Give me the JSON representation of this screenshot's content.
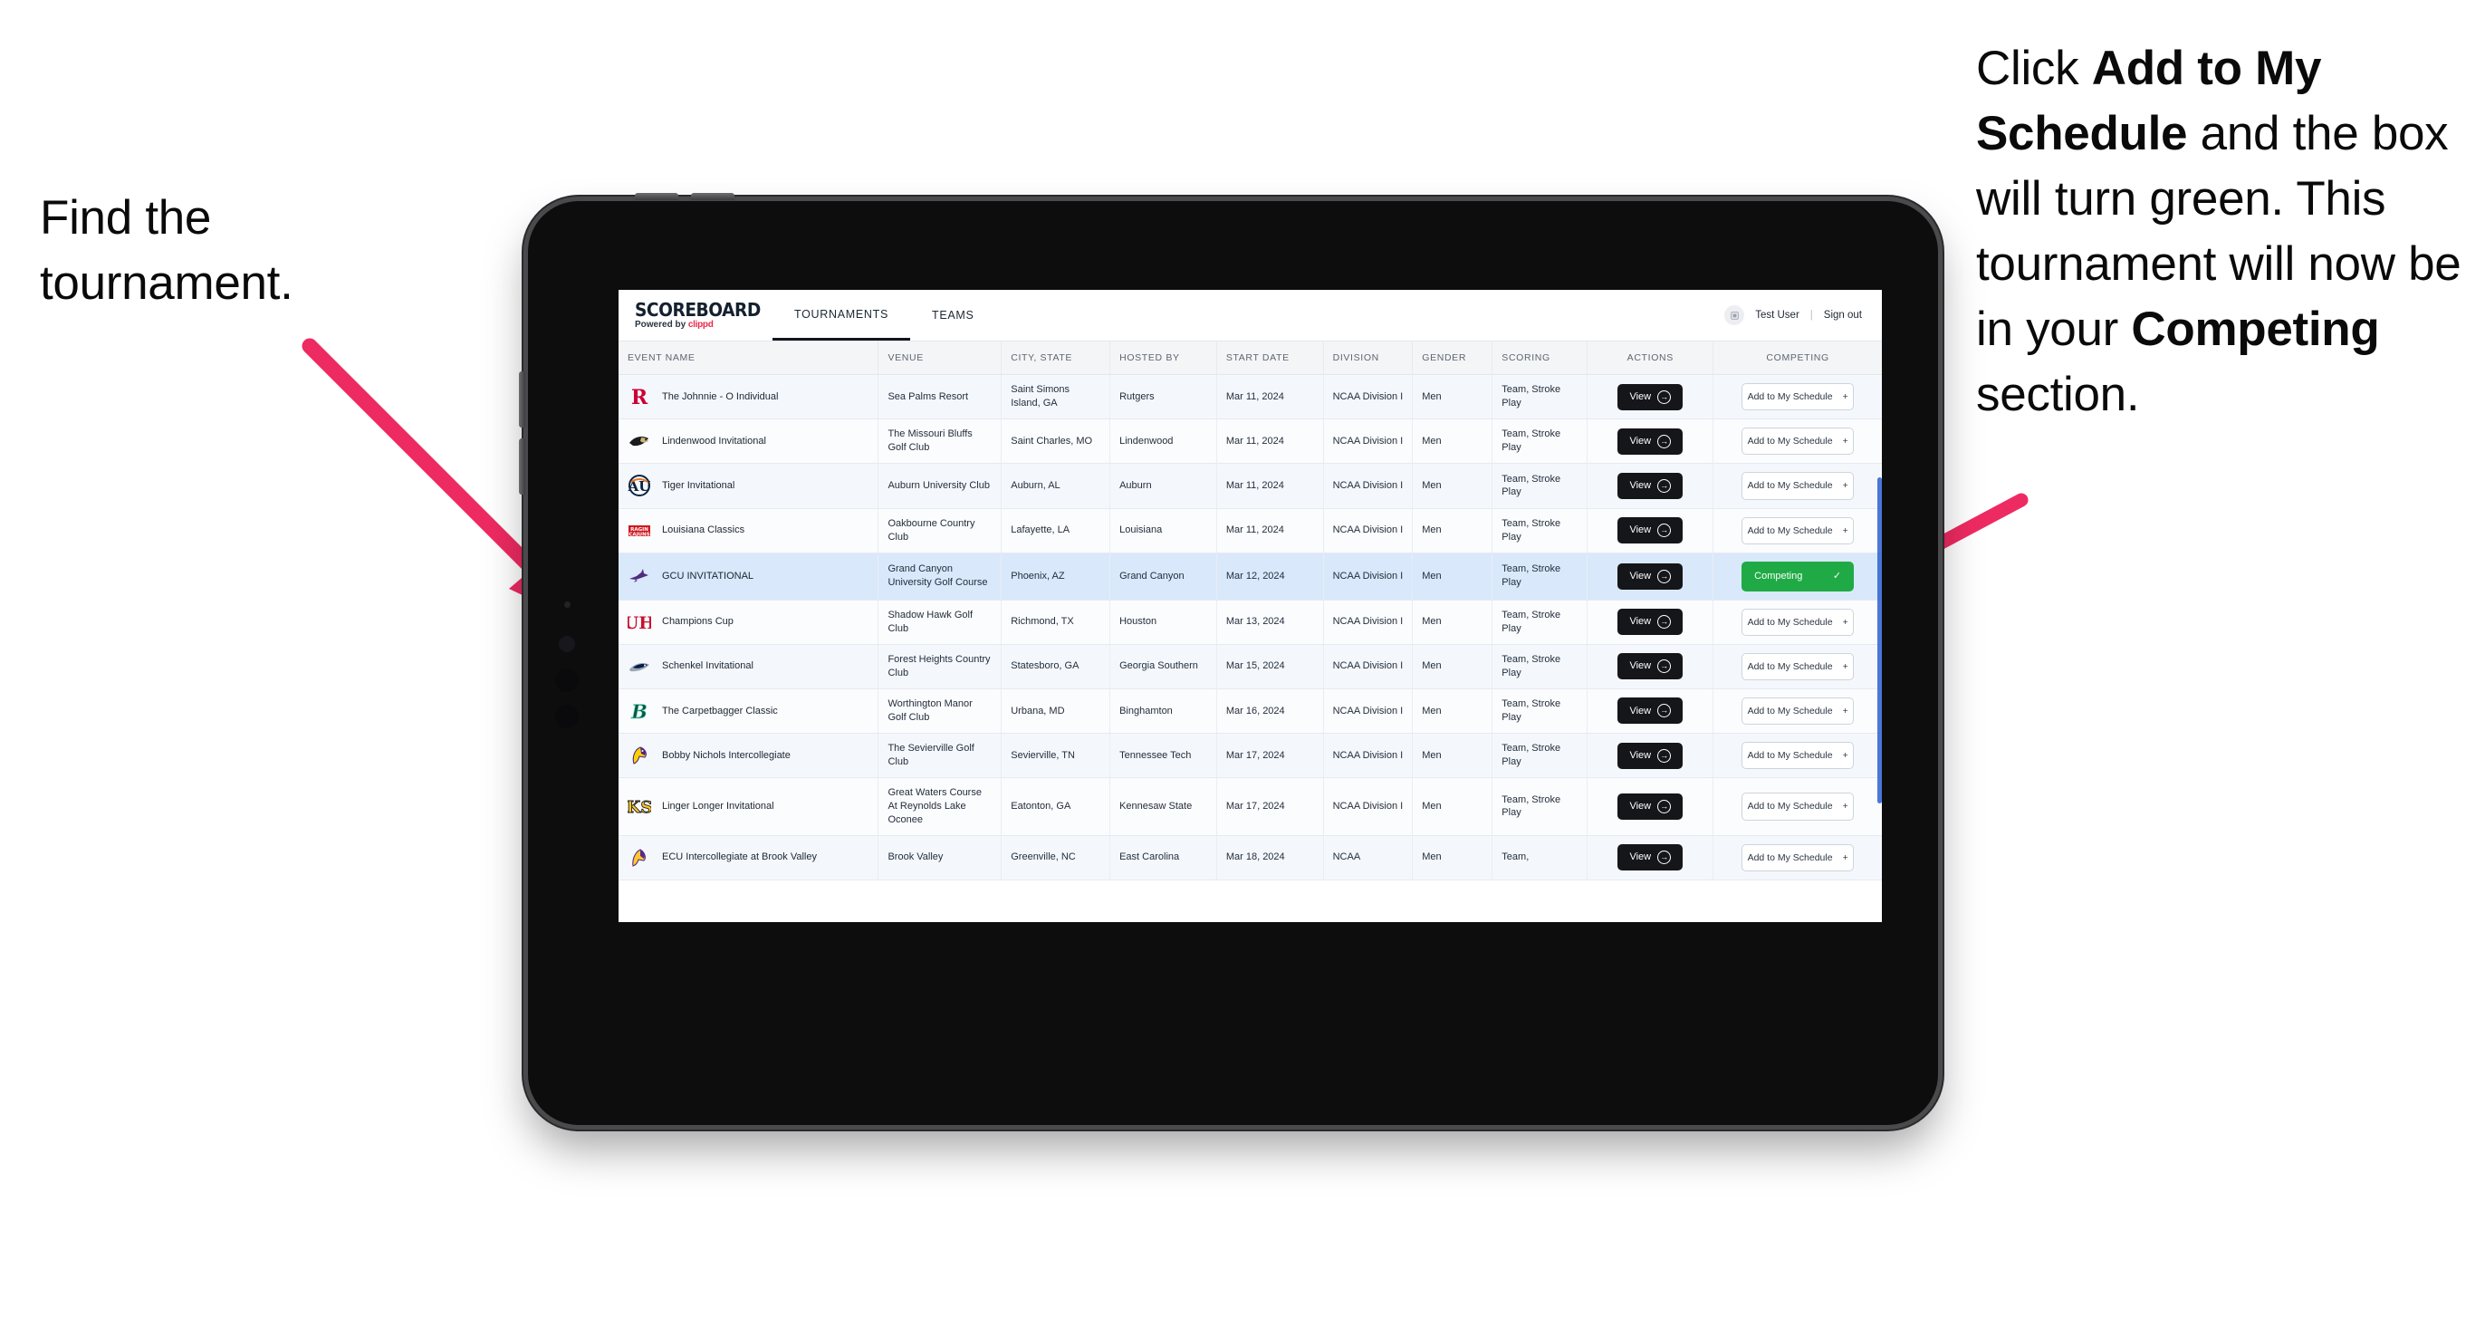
{
  "annotations": {
    "left": {
      "text": "Find the tournament."
    },
    "right": {
      "part1": "Click ",
      "bold1": "Add to My Schedule",
      "part2": " and the box will turn green. This tournament will now be in your ",
      "bold2": "Competing",
      "part3": " section."
    },
    "arrow_color": "#ee2a62"
  },
  "app": {
    "brand": {
      "title": "SCOREBOARD",
      "powered_prefix": "Powered by ",
      "powered_name": "clippd"
    },
    "nav": [
      {
        "label": "TOURNAMENTS",
        "active": true
      },
      {
        "label": "TEAMS",
        "active": false
      }
    ],
    "user": {
      "avatar_icon": "user-avatar-icon",
      "name": "Test User",
      "separator": "|",
      "sign_out": "Sign out"
    },
    "table": {
      "columns": [
        "EVENT NAME",
        "VENUE",
        "CITY, STATE",
        "HOSTED BY",
        "START DATE",
        "DIVISION",
        "GENDER",
        "SCORING",
        "ACTIONS",
        "COMPETING"
      ],
      "view_label": "View",
      "view_icon": "arrow-right-circle-icon",
      "add_label": "Add to My Schedule",
      "add_icon": "plus-icon",
      "competing_label": "Competing",
      "competing_icon": "check-icon",
      "competing_color": "#1faa45",
      "rows": [
        {
          "logo": "rutgers-logo",
          "event": "The Johnnie - O Individual",
          "venue": "Sea Palms Resort",
          "city": "Saint Simons Island, GA",
          "host": "Rutgers",
          "date": "Mar 11, 2024",
          "division": "NCAA Division I",
          "gender": "Men",
          "scoring": "Team, Stroke Play",
          "competing": false
        },
        {
          "logo": "lindenwood-logo",
          "event": "Lindenwood Invitational",
          "venue": "The Missouri Bluffs Golf Club",
          "city": "Saint Charles, MO",
          "host": "Lindenwood",
          "date": "Mar 11, 2024",
          "division": "NCAA Division I",
          "gender": "Men",
          "scoring": "Team, Stroke Play",
          "competing": false
        },
        {
          "logo": "auburn-logo",
          "event": "Tiger Invitational",
          "venue": "Auburn University Club",
          "city": "Auburn, AL",
          "host": "Auburn",
          "date": "Mar 11, 2024",
          "division": "NCAA Division I",
          "gender": "Men",
          "scoring": "Team, Stroke Play",
          "competing": false
        },
        {
          "logo": "louisiana-logo",
          "event": "Louisiana Classics",
          "venue": "Oakbourne Country Club",
          "city": "Lafayette, LA",
          "host": "Louisiana",
          "date": "Mar 11, 2024",
          "division": "NCAA Division I",
          "gender": "Men",
          "scoring": "Team, Stroke Play",
          "competing": false
        },
        {
          "logo": "gcu-logo",
          "event": "GCU INVITATIONAL",
          "venue": "Grand Canyon University Golf Course",
          "city": "Phoenix, AZ",
          "host": "Grand Canyon",
          "date": "Mar 12, 2024",
          "division": "NCAA Division I",
          "gender": "Men",
          "scoring": "Team, Stroke Play",
          "competing": true
        },
        {
          "logo": "houston-logo",
          "event": "Champions Cup",
          "venue": "Shadow Hawk Golf Club",
          "city": "Richmond, TX",
          "host": "Houston",
          "date": "Mar 13, 2024",
          "division": "NCAA Division I",
          "gender": "Men",
          "scoring": "Team, Stroke Play",
          "competing": false
        },
        {
          "logo": "georgia-southern-logo",
          "event": "Schenkel Invitational",
          "venue": "Forest Heights Country Club",
          "city": "Statesboro, GA",
          "host": "Georgia Southern",
          "date": "Mar 15, 2024",
          "division": "NCAA Division I",
          "gender": "Men",
          "scoring": "Team, Stroke Play",
          "competing": false
        },
        {
          "logo": "binghamton-logo",
          "event": "The Carpetbagger Classic",
          "venue": "Worthington Manor Golf Club",
          "city": "Urbana, MD",
          "host": "Binghamton",
          "date": "Mar 16, 2024",
          "division": "NCAA Division I",
          "gender": "Men",
          "scoring": "Team, Stroke Play",
          "competing": false
        },
        {
          "logo": "tennessee-tech-logo",
          "event": "Bobby Nichols Intercollegiate",
          "venue": "The Sevierville Golf Club",
          "city": "Sevierville, TN",
          "host": "Tennessee Tech",
          "date": "Mar 17, 2024",
          "division": "NCAA Division I",
          "gender": "Men",
          "scoring": "Team, Stroke Play",
          "competing": false
        },
        {
          "logo": "kennesaw-logo",
          "event": "Linger Longer Invitational",
          "venue": "Great Waters Course At Reynolds Lake Oconee",
          "city": "Eatonton, GA",
          "host": "Kennesaw State",
          "date": "Mar 17, 2024",
          "division": "NCAA Division I",
          "gender": "Men",
          "scoring": "Team, Stroke Play",
          "competing": false
        },
        {
          "logo": "ecu-logo",
          "event": "ECU Intercollegiate at Brook Valley",
          "venue": "Brook Valley",
          "city": "Greenville, NC",
          "host": "East Carolina",
          "date": "Mar 18, 2024",
          "division": "NCAA",
          "gender": "Men",
          "scoring": "Team,",
          "competing": false
        }
      ]
    }
  }
}
